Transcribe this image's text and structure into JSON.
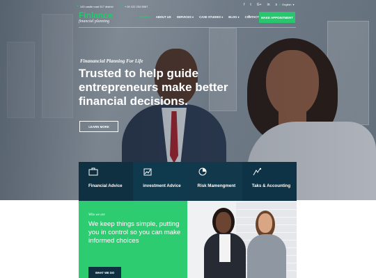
{
  "topbar": {
    "address": "143 castle road 517 district",
    "phone": "+ 00 122 234 5567",
    "social_icons": [
      "facebook-icon",
      "twitter-icon",
      "google-plus-icon",
      "linkedin-icon",
      "skype-icon"
    ],
    "language": "English"
  },
  "logo": {
    "name": "Finlance",
    "tagline": "financial planning"
  },
  "nav": {
    "items": [
      {
        "label": "HOME",
        "caret": true,
        "active": true
      },
      {
        "label": "ABOUT US",
        "caret": false,
        "active": false
      },
      {
        "label": "SERVICES",
        "caret": true,
        "active": false
      },
      {
        "label": "CASE STUDIES",
        "caret": true,
        "active": false
      },
      {
        "label": "BLOG",
        "caret": true,
        "active": false
      },
      {
        "label": "CONTACT",
        "caret": false,
        "active": false
      }
    ],
    "cta": "MAKE APPOINTMENT"
  },
  "hero": {
    "kicker": "Finanancial Planning For Life",
    "title": "Trusted to help guide entrepreneurs make better financial decisions.",
    "button": "LEARN MORE"
  },
  "services": [
    {
      "label": "Financial Advice",
      "icon": "briefcase-icon"
    },
    {
      "label": "investment Advice",
      "icon": "investment-icon"
    },
    {
      "label": "Risk Mamengment",
      "icon": "pie-chart-icon"
    },
    {
      "label": "Taks & Accounting",
      "icon": "calculator-icon"
    }
  ],
  "who": {
    "kicker": "Who we are",
    "text": "We keep things simple, putting you in control so you can make informed choices",
    "button": "WHAT WE DO"
  },
  "colors": {
    "accent": "#2ecc71",
    "navy": "#0f3041"
  }
}
